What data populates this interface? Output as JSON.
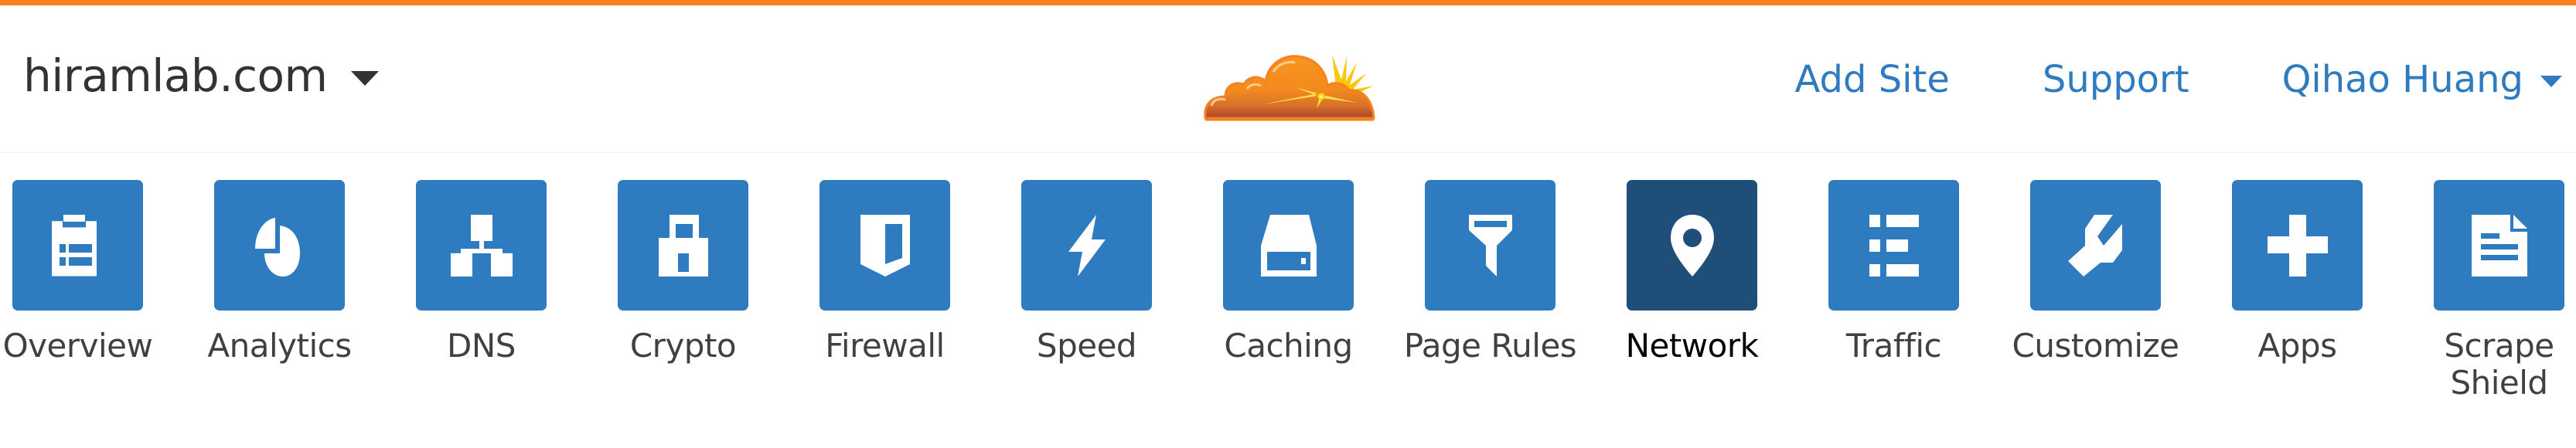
{
  "theme": {
    "top_bar_color": "#f6821f",
    "tile_color": "#2f7bbf",
    "tile_active_color": "#1f4e79",
    "link_color": "#2f7bbf"
  },
  "header": {
    "zone_name": "hiramlab.com",
    "zone_dropdown_icon": "caret-down-icon",
    "logo": "cloudflare-logo",
    "links": [
      {
        "label": "Add Site"
      },
      {
        "label": "Support"
      },
      {
        "label": "Qihao Huang",
        "icon": "caret-down-icon"
      }
    ]
  },
  "nav": {
    "active": "Network",
    "items": [
      {
        "label": "Overview",
        "icon": "clipboard-icon"
      },
      {
        "label": "Analytics",
        "icon": "pie-chart-icon"
      },
      {
        "label": "DNS",
        "icon": "sitemap-icon"
      },
      {
        "label": "Crypto",
        "icon": "lock-icon"
      },
      {
        "label": "Firewall",
        "icon": "shield-icon"
      },
      {
        "label": "Speed",
        "icon": "lightning-icon"
      },
      {
        "label": "Caching",
        "icon": "hard-drive-icon"
      },
      {
        "label": "Page Rules",
        "icon": "filter-icon"
      },
      {
        "label": "Network",
        "icon": "map-pin-icon"
      },
      {
        "label": "Traffic",
        "icon": "list-icon"
      },
      {
        "label": "Customize",
        "icon": "wrench-icon"
      },
      {
        "label": "Apps",
        "icon": "plus-icon"
      },
      {
        "label": "Scrape Shield",
        "icon": "document-icon"
      }
    ]
  }
}
